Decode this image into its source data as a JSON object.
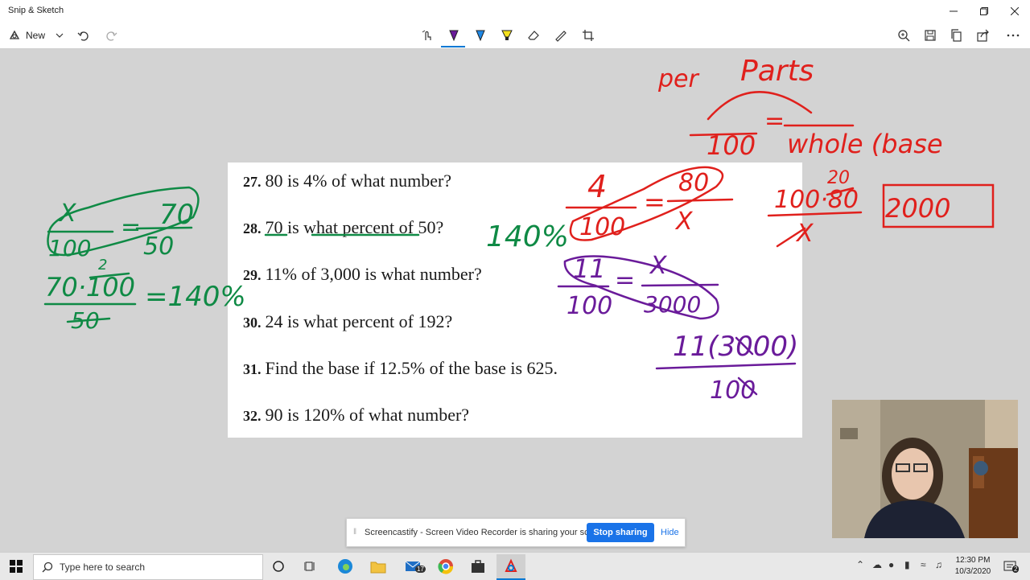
{
  "window": {
    "title": "Snip & Sketch"
  },
  "toolbar": {
    "new_label": "New",
    "tools": [
      "touch-writing-icon",
      "ballpoint-pen-icon",
      "pencil-icon",
      "highlighter-icon",
      "eraser-icon",
      "ruler-icon",
      "crop-icon"
    ],
    "right_tools": [
      "zoom-icon",
      "save-icon",
      "copy-icon",
      "share-icon",
      "more-icon"
    ]
  },
  "worksheet": {
    "problems": [
      {
        "num": "27.",
        "text": "80 is 4% of what number?"
      },
      {
        "num": "28.",
        "text": "70 is what percent of 50?"
      },
      {
        "num": "29.",
        "text": "11% of 3,000 is what number?"
      },
      {
        "num": "30.",
        "text": "24 is what percent of 192?"
      },
      {
        "num": "31.",
        "text": "Find the base if 12.5% of the base is 625."
      },
      {
        "num": "32.",
        "text": "90 is 120% of what number?"
      }
    ]
  },
  "ink": {
    "colors": {
      "red": "#e0201c",
      "green": "#0f8a45",
      "purple": "#6a1b9a"
    },
    "red_top": {
      "per": "per",
      "parts": "Parts",
      "eq": "=",
      "hundred": "100",
      "whole": "whole (base"
    },
    "red_27": {
      "four": "4",
      "eq": "=",
      "eighty": "80",
      "hundred": "100",
      "x": "X"
    },
    "red_side": {
      "twenty": "20",
      "expr": "100·80",
      "x": "X",
      "answer": "2000"
    },
    "green_28": {
      "answer": "140%",
      "x": "X",
      "eq": "=",
      "seventy": "70",
      "hundred": "100",
      "fifty": "50",
      "two": "2",
      "calc_num": "70·100",
      "calc_den": "50",
      "calc_eq": "=140%"
    },
    "purple_29": {
      "eleven": "11",
      "eq": "=",
      "x": "X",
      "hundred": "100",
      "threek": "3000",
      "numer": "11(3000)",
      "denom": "100"
    }
  },
  "share_banner": {
    "message": "Screencastify - Screen Video Recorder is sharing your screen.",
    "stop_label": "Stop sharing",
    "hide_label": "Hide"
  },
  "taskbar": {
    "search_placeholder": "Type here to search",
    "mail_badge": "17",
    "time": "12:30 PM",
    "date": "10/3/2020",
    "notification_count": "2"
  }
}
